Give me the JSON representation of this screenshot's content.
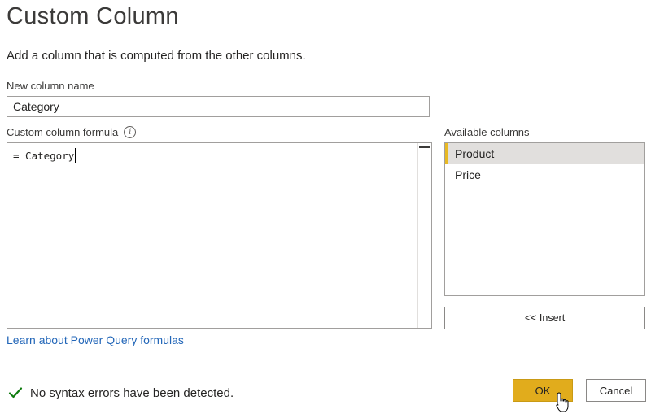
{
  "dialog": {
    "title": "Custom Column",
    "subtitle": "Add a column that is computed from the other columns."
  },
  "new_column": {
    "label": "New column name",
    "value": "Category"
  },
  "formula": {
    "label": "Custom column formula",
    "info_icon": "info-icon",
    "value": "= Category"
  },
  "available_columns": {
    "label": "Available columns",
    "items": [
      {
        "label": "Product",
        "selected": true
      },
      {
        "label": "Price",
        "selected": false
      }
    ],
    "insert_label": "<< Insert"
  },
  "learn_link": "Learn about Power Query formulas",
  "status": {
    "icon": "checkmark-icon",
    "text": "No syntax errors have been detected."
  },
  "buttons": {
    "ok": "OK",
    "cancel": "Cancel"
  },
  "colors": {
    "accent": "#e1ac1c",
    "selection_marker": "#e8b923",
    "link": "#2266b8",
    "success": "#107c10"
  }
}
